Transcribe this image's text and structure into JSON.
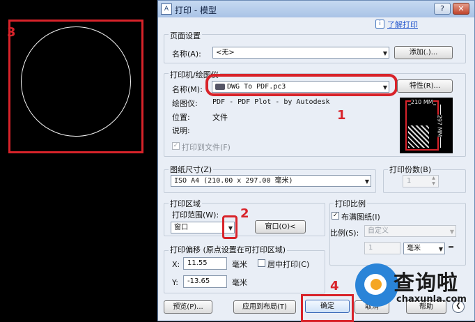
{
  "annotations": {
    "a1": "1",
    "a2": "2",
    "a3": "3",
    "a4": "4"
  },
  "dialog": {
    "title": "打印 - 模型",
    "help_link": "了解打印",
    "page_setup": {
      "group_label": "页面设置",
      "name_label": "名称(A):",
      "name_value": "<无>",
      "add_button": "添加(.)..."
    },
    "printer": {
      "group_label": "打印机/绘图仪",
      "name_label": "名称(M):",
      "name_value": "DWG To PDF.pc3",
      "properties_button": "特性(R)...",
      "plotter_label": "绘图仪:",
      "plotter_value": "PDF - PDF Plot - by Autodesk",
      "location_label": "位置:",
      "location_value": "文件",
      "description_label": "说明:",
      "print_to_file": "打印到文件(F)",
      "preview_width": "210 MM",
      "preview_height": "297 MM"
    },
    "paper_size": {
      "group_label": "图纸尺寸(Z)",
      "value": "ISO A4 (210.00 x 297.00 毫米)"
    },
    "copies": {
      "group_label": "打印份数(B)",
      "value": "1"
    },
    "plot_area": {
      "group_label": "打印区域",
      "range_label": "打印范围(W):",
      "range_value": "窗口",
      "window_button": "窗口(O)<"
    },
    "plot_scale": {
      "group_label": "打印比例",
      "fit_paper": "布满图纸(I)",
      "scale_label": "比例(S):",
      "scale_value": "自定义",
      "value1": "1",
      "unit": "毫米"
    },
    "plot_offset": {
      "group_label": "打印偏移 (原点设置在可打印区域)",
      "x_label": "X:",
      "x_value": "11.55",
      "x_unit": "毫米",
      "y_label": "Y:",
      "y_value": "-13.65",
      "y_unit": "毫米",
      "center": "居中打印(C)"
    },
    "buttons": {
      "preview": "预览(P)...",
      "apply_layout": "应用到布局(T)",
      "ok": "确定",
      "cancel": "取消",
      "help": "帮助"
    }
  },
  "watermark": {
    "text": "查询啦",
    "sub": "chaxunla.com"
  }
}
